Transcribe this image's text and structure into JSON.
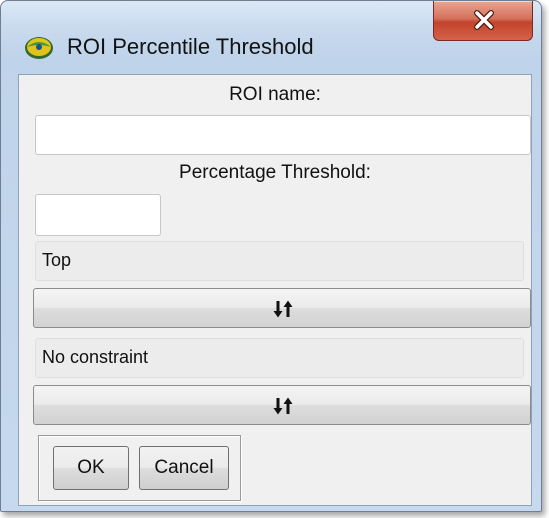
{
  "window": {
    "title": "ROI Percentile Threshold",
    "app_icon": "app-logo-icon",
    "close_icon": "close-icon",
    "close_button_color": "#c2432b"
  },
  "form": {
    "roi_name_label": "ROI name:",
    "roi_name_value": "",
    "threshold_label": "Percentage Threshold:",
    "threshold_value": "",
    "direction_value": "Top",
    "direction_sort_icon": "sort-toggle-icon",
    "constraint_value": "No constraint",
    "constraint_sort_icon": "sort-toggle-icon"
  },
  "buttons": {
    "ok_label": "OK",
    "cancel_label": "Cancel"
  }
}
